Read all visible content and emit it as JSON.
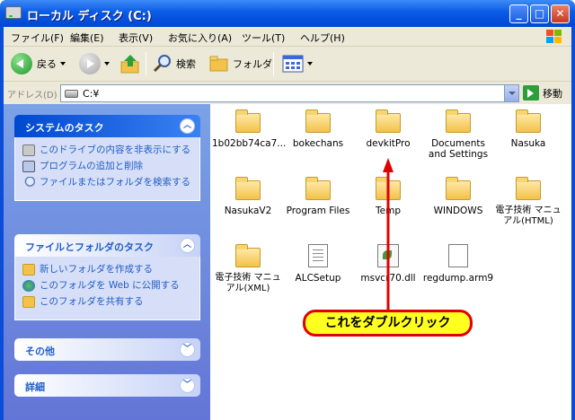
{
  "window": {
    "title": "ローカル ディスク (C:)"
  },
  "title_buttons": {
    "minimize": "_",
    "maximize": "□",
    "close": "✕"
  },
  "menu": [
    "ファイル(F)",
    "編集(E)",
    "表示(V)",
    "お気に入り(A)",
    "ツール(T)",
    "ヘルプ(H)"
  ],
  "toolbar": {
    "back": "戻る",
    "search": "検索",
    "folders": "フォルダ"
  },
  "address": {
    "label": "アドレス(D)",
    "value": "C:¥",
    "go": "移動"
  },
  "tasks": {
    "system": {
      "title": "システムのタスク",
      "items": [
        "このドライブの内容を非表示にする",
        "プログラムの追加と削除",
        "ファイルまたはフォルダを検索する"
      ]
    },
    "file_folder": {
      "title": "ファイルとフォルダのタスク",
      "items": [
        "新しいフォルダを作成する",
        "このフォルダを Web に公開する",
        "このフォルダを共有する"
      ]
    },
    "other": {
      "title": "その他"
    },
    "details": {
      "title": "詳細"
    }
  },
  "files": [
    {
      "name": "1b02bb74ca7...",
      "icon": "folder"
    },
    {
      "name": "bokechans",
      "icon": "folder"
    },
    {
      "name": "devkitPro",
      "icon": "folder"
    },
    {
      "name": "Documents and Settings",
      "icon": "folder"
    },
    {
      "name": "Nasuka",
      "icon": "folder"
    },
    {
      "name": "NasukaV2",
      "icon": "folder"
    },
    {
      "name": "Program Files",
      "icon": "folder"
    },
    {
      "name": "Temp",
      "icon": "folder"
    },
    {
      "name": "WINDOWS",
      "icon": "folder"
    },
    {
      "name": "電子技術 マニュアル(HTML)",
      "icon": "folder"
    },
    {
      "name": "電子技術 マニュアル(XML)",
      "icon": "folder"
    },
    {
      "name": "ALCSetup",
      "icon": "text-file"
    },
    {
      "name": "msvcr70.dll",
      "icon": "dll-file"
    },
    {
      "name": "regdump.arm9",
      "icon": "file"
    }
  ],
  "annotation": {
    "callout": "これをダブルクリック",
    "color": "#E00000"
  }
}
